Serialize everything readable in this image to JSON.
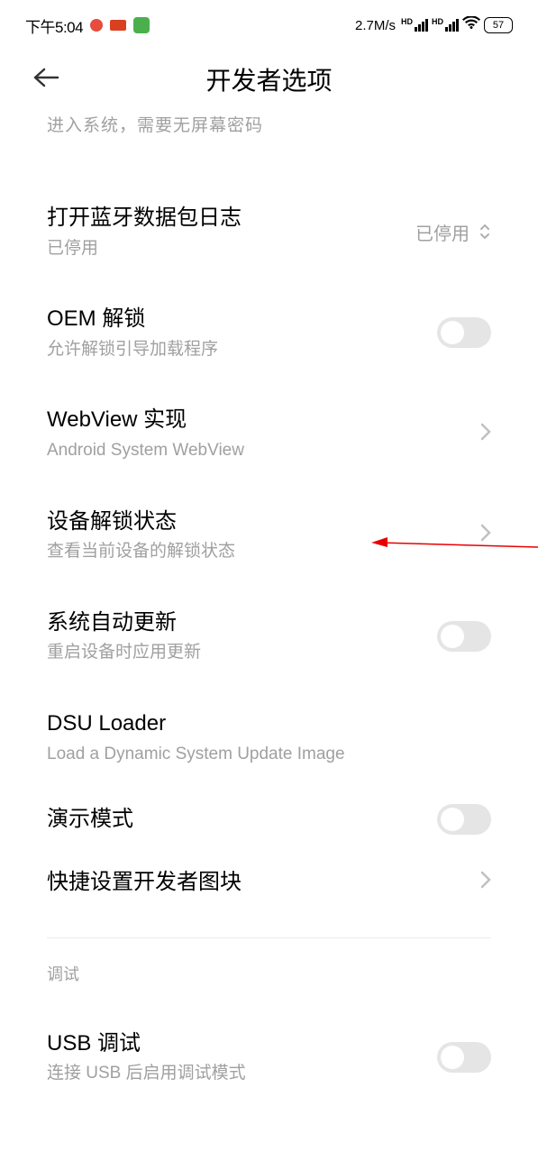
{
  "status_bar": {
    "time": "下午5:04",
    "net_speed": "2.7M/s",
    "battery": "57"
  },
  "header": {
    "title": "开发者选项"
  },
  "truncated_text": "进入系统，需要无屏幕密码",
  "items": {
    "bluetooth_log": {
      "title": "打开蓝牙数据包日志",
      "subtitle": "已停用",
      "value": "已停用"
    },
    "oem_unlock": {
      "title": "OEM 解锁",
      "subtitle": "允许解锁引导加载程序"
    },
    "webview": {
      "title": "WebView 实现",
      "subtitle": "Android System WebView"
    },
    "unlock_status": {
      "title": "设备解锁状态",
      "subtitle": "查看当前设备的解锁状态"
    },
    "auto_update": {
      "title": "系统自动更新",
      "subtitle": "重启设备时应用更新"
    },
    "dsu_loader": {
      "title": "DSU Loader",
      "subtitle": "Load a Dynamic System Update Image"
    },
    "demo_mode": {
      "title": "演示模式"
    },
    "quick_tiles": {
      "title": "快捷设置开发者图块"
    },
    "debug_section": "调试",
    "usb_debug": {
      "title": "USB 调试",
      "subtitle": "连接 USB 后启用调试模式"
    }
  }
}
